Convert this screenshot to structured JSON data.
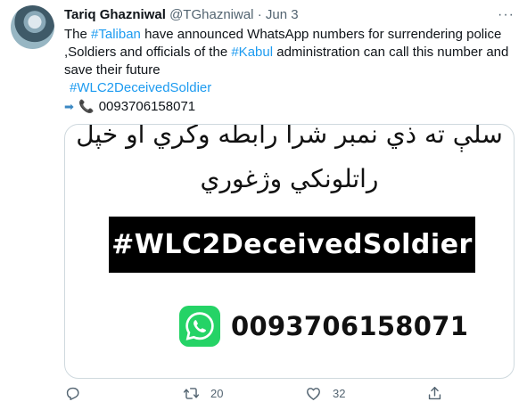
{
  "tweet": {
    "author": {
      "name": "Tariq Ghazniwal",
      "handle": "@TGhazniwal",
      "separator": "·",
      "date": "Jun 3"
    },
    "more_label": "···",
    "text": {
      "line1_pre": "The ",
      "hashtag_taliban": "#Taliban",
      "line1_post": " have announced WhatsApp numbers for surrendering police",
      "line2_pre": ",Soldiers and officials of the ",
      "hashtag_kabul": "#Kabul",
      "line2_post": " administration can call this number and",
      "line3": "save their future",
      "hashtag_wlc": "#WLC2DeceivedSoldier",
      "phone": "0093706158071"
    },
    "media": {
      "pashto_line_1": "سلې ته ذي نمبر شرا رابطه وكري او خپل",
      "pashto_line_2": "راتلونكي وژغوري",
      "banner": "#WLC2DeceivedSoldier",
      "whatsapp_number": "0093706158071",
      "accent_color": "#25d366"
    },
    "actions": {
      "retweet_count": "20",
      "like_count": "32"
    }
  },
  "colors": {
    "link": "#1d9bf0",
    "text": "#0f1419",
    "secondary": "#536471"
  }
}
